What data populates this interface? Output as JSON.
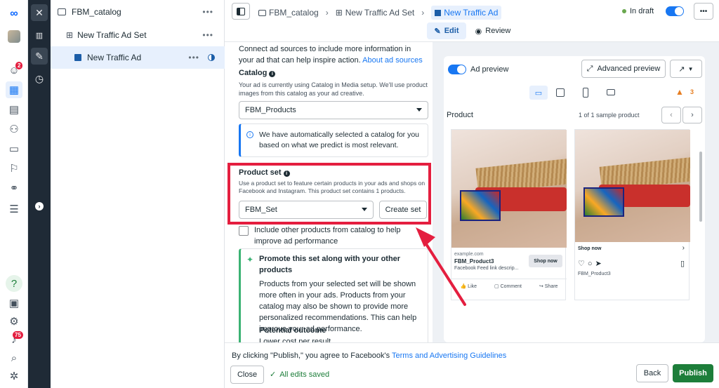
{
  "tree": {
    "campaign": "FBM_catalog",
    "adset": "New Traffic Ad Set",
    "ad": "New Traffic Ad",
    "dots": "•••"
  },
  "badges": {
    "notifications_top": "2",
    "notifications_bottom": "75"
  },
  "topbar": {
    "crumbs": [
      "FBM_catalog",
      "New Traffic Ad Set",
      "New Traffic Ad"
    ],
    "status": "In draft",
    "more": "•••",
    "edit_label": "Edit",
    "review_label": "Review"
  },
  "form": {
    "ad_sources_text": "Connect ad sources to include more information in your ad that can help inspire action.",
    "ad_sources_link": "About ad sources",
    "catalog_label": "Catalog",
    "catalog_help": "Your ad is currently using Catalog in Media setup. We'll use product images from this catalog as your ad creative.",
    "catalog_value": "FBM_Products",
    "catalog_info": "We have automatically selected a catalog for you based on what we predict is most relevant.",
    "product_set_label": "Product set",
    "product_set_help": "Use a product set to feature certain products in your ads and shops on Facebook and Instagram. This product set contains 1 products.",
    "product_set_value": "FBM_Set",
    "create_set_label": "Create set",
    "include_label": "Include other products from catalog to help improve ad performance",
    "promote_title": "Promote this set along with your other products",
    "promote_body": "Products from your selected set will be shown more often in your ads. Products from your catalog may also be shown to provide more personalized recommendations. This can help improve your ad performance.",
    "outcome_title": "Potential outcome",
    "outcome_body": "Lower cost per result"
  },
  "preview": {
    "toggle_label": "Ad preview",
    "advanced_label": "Advanced preview",
    "warning_count": "3",
    "product_label": "Product",
    "sample_count": "1 of 1 sample product",
    "fb_domain": "example.com",
    "fb_product": "FBM_Product3",
    "fb_desc": "Facebook Feed link descrip...",
    "fb_cta": "Shop now",
    "fb_like": "Like",
    "fb_comment": "Comment",
    "fb_share": "Share",
    "ig_cta": "Shop now",
    "ig_product": "FBM_Product3"
  },
  "bottom": {
    "terms_prefix": "By clicking \"Publish,\" you agree to Facebook's",
    "terms_link": "Terms and Advertising Guidelines",
    "close_label": "Close",
    "saved_label": "All edits saved",
    "back_label": "Back",
    "publish_label": "Publish"
  },
  "colors": {
    "accent": "#1877f2",
    "publish": "#1d7e3a",
    "annotation": "#e41e3f",
    "dark_rail": "#1f2a36",
    "warning": "#f7b928"
  }
}
